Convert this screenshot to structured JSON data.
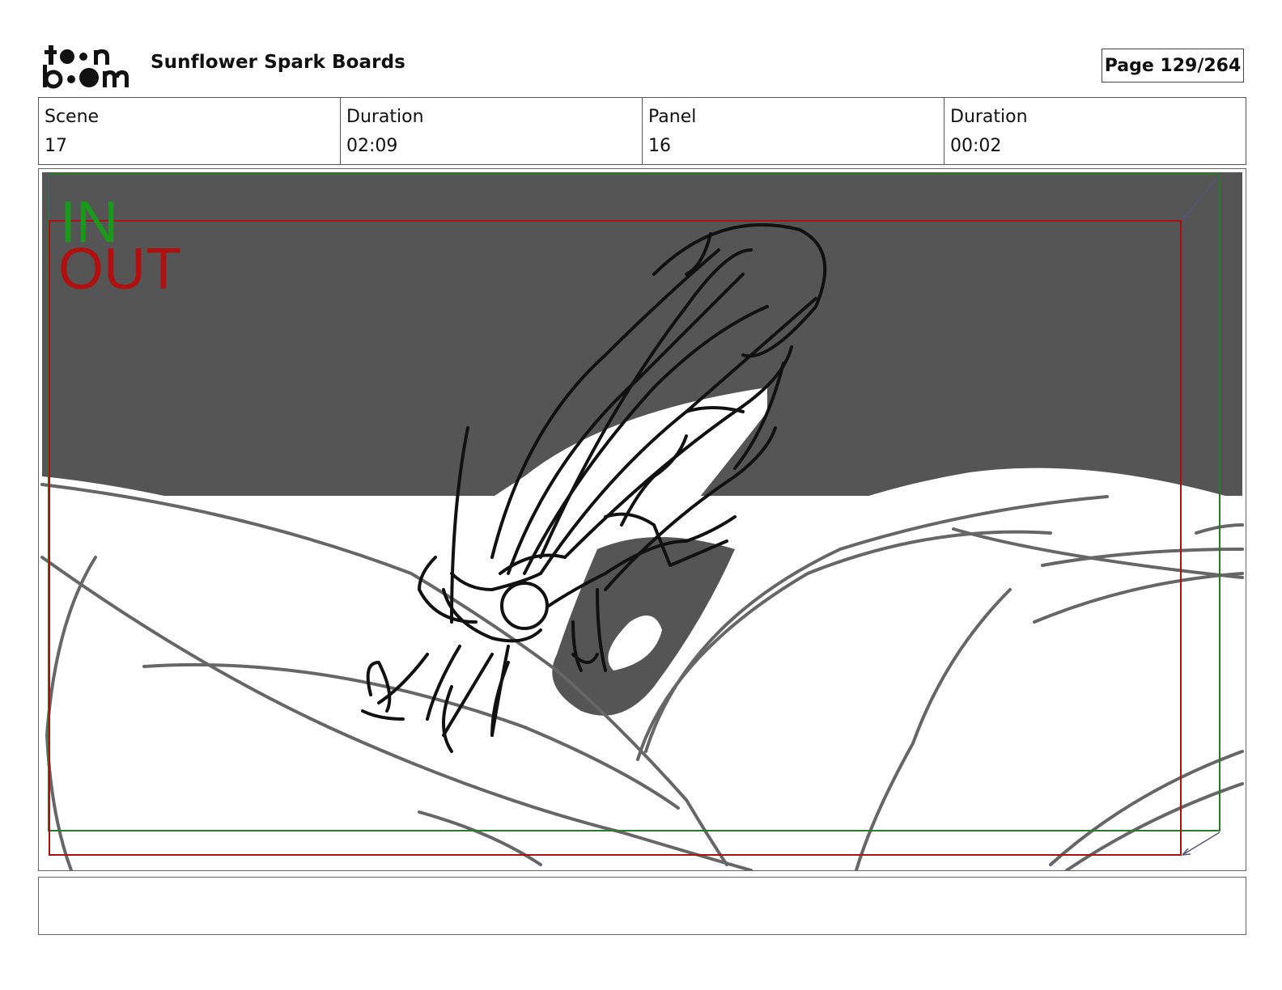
{
  "header": {
    "logo_text": "toon boom",
    "project_title": "Sunflower Spark Boards",
    "page_label": "Page 129/264"
  },
  "info": [
    {
      "label": "Scene",
      "value": "17"
    },
    {
      "label": "Duration",
      "value": "02:09"
    },
    {
      "label": "Panel",
      "value": "16"
    },
    {
      "label": "Duration",
      "value": "00:02"
    }
  ],
  "panel": {
    "in_label": "IN",
    "out_label": "OUT",
    "in_color": "#1a9a1a",
    "out_color": "#b01010",
    "sky_color": "#555555"
  },
  "notes": {
    "text": ""
  }
}
